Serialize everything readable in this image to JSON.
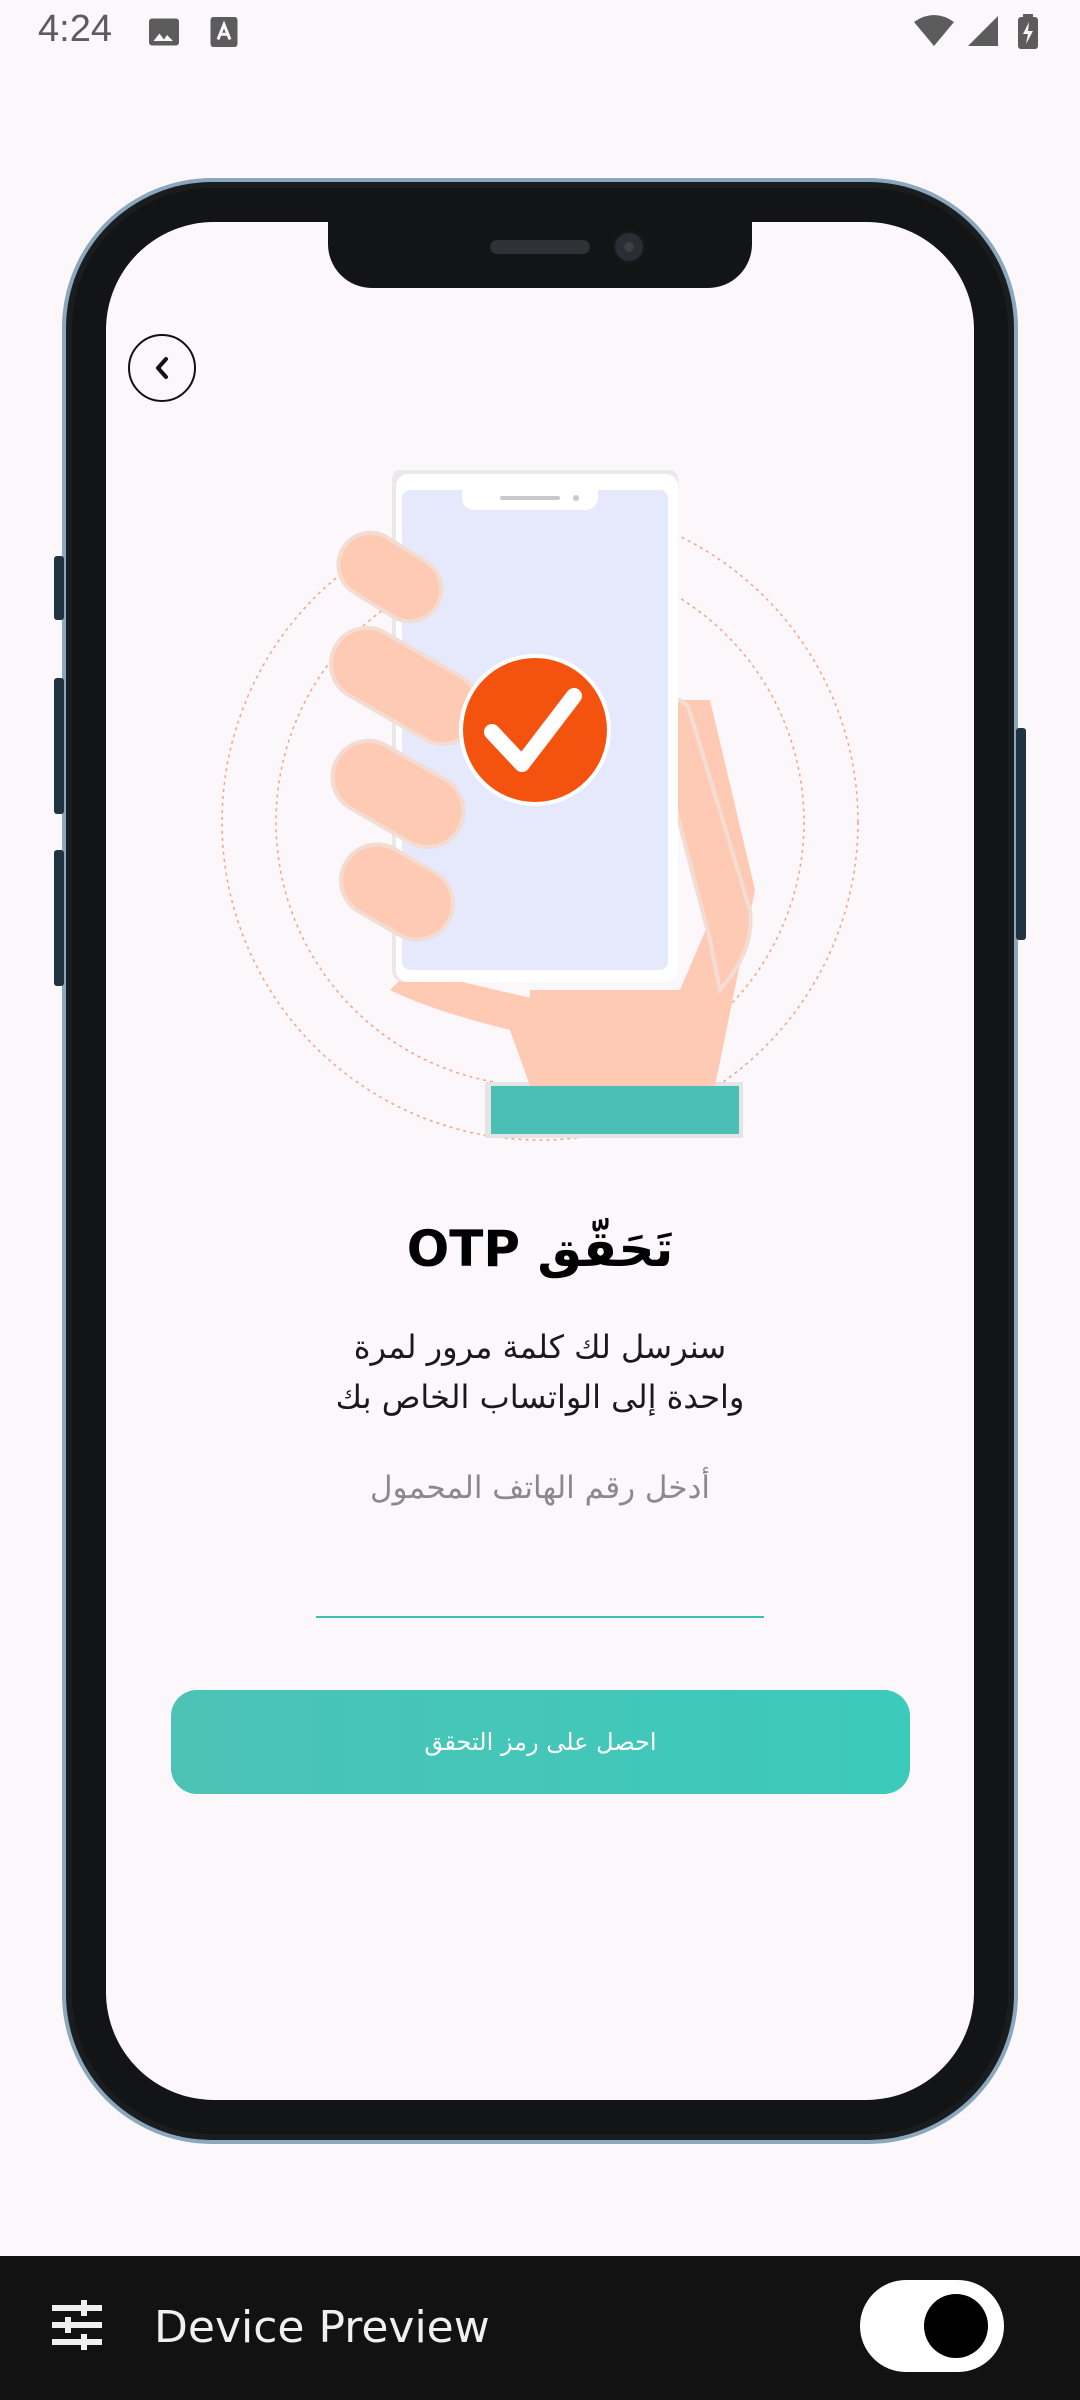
{
  "status_bar": {
    "time": "4:24"
  },
  "screen": {
    "title": "تَحَقّق OTP",
    "subtitle_line1": "سنرسل لك كلمة مرور لمرة",
    "subtitle_line2": "واحدة إلى الواتساب الخاص بك",
    "phone_input": {
      "placeholder": "أدخل رقم الهاتف المحمول",
      "value": ""
    },
    "cta_label": "احصل على رمز التحقق"
  },
  "bottom_bar": {
    "label": "Device Preview",
    "toggle_on": true
  },
  "colors": {
    "accent": "#3bc4b6",
    "check": "#f4520f",
    "background": "#fcf7fb"
  }
}
